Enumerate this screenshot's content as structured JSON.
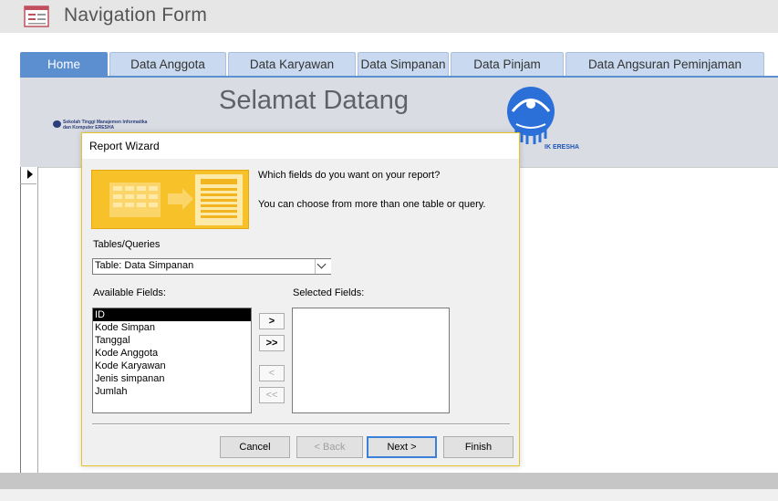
{
  "window": {
    "title": "Navigation Form"
  },
  "tabs": [
    {
      "label": "Home",
      "active": true
    },
    {
      "label": "Data Anggota"
    },
    {
      "label": "Data Karyawan"
    },
    {
      "label": "Data Simpanan"
    },
    {
      "label": "Data Pinjam"
    },
    {
      "label": "Data Angsuran Peminjaman"
    }
  ],
  "header": {
    "welcome": "Selamat Datang",
    "logo_small_line1": "Sekolah Tinggi Manajemen Informatika",
    "logo_small_line2": "dan Komputer ERESHA",
    "logo_caption": "IK ERESHA"
  },
  "dialog": {
    "title": "Report Wizard",
    "question": "Which fields do you want on your report?",
    "hint": "You can choose from more than one table or query.",
    "tables_label": "Tables/Queries",
    "table_selected": "Table: Data Simpanan",
    "available_label": "Available Fields:",
    "selected_label": "Selected Fields:",
    "available_fields": [
      "ID",
      "Kode Simpan",
      "Tanggal",
      "Kode Anggota",
      "Kode Karyawan",
      "Jenis simpanan",
      "Jumlah"
    ],
    "selected_fields": [],
    "move_buttons": [
      ">",
      ">>",
      "<",
      "<<"
    ],
    "buttons": {
      "cancel": "Cancel",
      "back": "< Back",
      "next": "Next >",
      "finish": "Finish"
    }
  },
  "colors": {
    "accent": "#5b8fd0",
    "tab_bg": "#c9daf0",
    "dialog_border": "#e8c22a"
  },
  "icons": [
    "form-icon",
    "wizard-graphic",
    "record-arrow-icon",
    "chevron-down-icon"
  ]
}
